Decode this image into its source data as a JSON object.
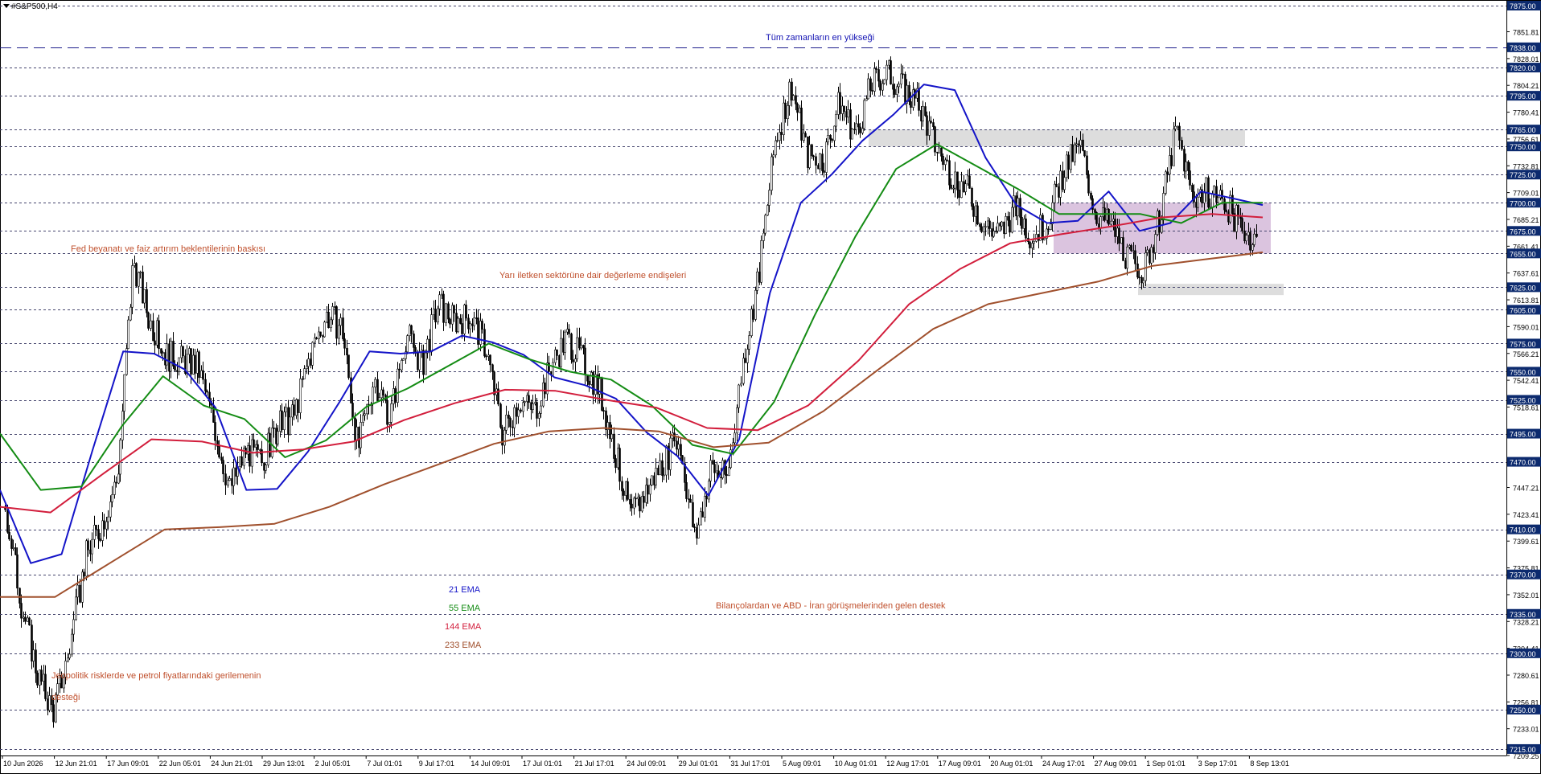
{
  "symbol": "#S&P500,H4",
  "chart_data": {
    "type": "candlestick",
    "title": "#S&P500,H4",
    "xlabel": "",
    "ylabel": "",
    "ylim": [
      7209.25,
      7880
    ],
    "grid": false,
    "price_ticks": [
      "7851.81",
      "7828.01",
      "7804.21",
      "7780.41",
      "7756.61",
      "7732.81",
      "7709.01",
      "7685.21",
      "7661.41",
      "7637.61",
      "7613.81",
      "7590.01",
      "7566.21",
      "7542.41",
      "7518.61",
      "7494.81",
      "7471.01",
      "7447.21",
      "7423.41",
      "7399.61",
      "7375.81",
      "7352.01",
      "7328.21",
      "7304.41",
      "7280.61",
      "7256.81",
      "7233.01",
      "7209.25"
    ],
    "level_labels": [
      "7875.00",
      "7838.00",
      "7820.00",
      "7795.00",
      "7765.00",
      "7750.00",
      "7725.00",
      "7700.00",
      "7675.00",
      "7655.00",
      "7625.00",
      "7605.00",
      "7575.00",
      "7550.00",
      "7525.00",
      "7495.00",
      "7470.00",
      "7410.00",
      "7370.00",
      "7335.00",
      "7300.00",
      "7250.00",
      "7215.00"
    ],
    "levels": [
      7875,
      7838,
      7820,
      7795,
      7765,
      7750,
      7725,
      7700,
      7675,
      7655,
      7625,
      7605,
      7575,
      7550,
      7525,
      7495,
      7470,
      7410,
      7370,
      7335,
      7300,
      7250,
      7215
    ],
    "ath_level": 7838,
    "x_labels": [
      "10 Jun 2026",
      "12 Jun 21:01",
      "17 Jun 09:01",
      "22 Jun 05:01",
      "24 Jun 21:01",
      "29 Jun 13:01",
      "2 Jul 05:01",
      "7 Jul 01:01",
      "9 Jul 17:01",
      "14 Jul 09:01",
      "17 Jul 01:01",
      "21 Jul 17:01",
      "24 Jul 09:01",
      "29 Jul 01:01",
      "31 Jul 17:01",
      "5 Aug 09:01",
      "10 Aug 01:01",
      "12 Aug 17:01",
      "17 Aug 09:01",
      "20 Aug 01:01",
      "24 Aug 17:01",
      "27 Aug 09:01",
      "1 Sep 01:01",
      "3 Sep 17:01",
      "8 Sep 13:01"
    ],
    "anchors": [
      7430,
      7345,
      7282,
      7248,
      7302,
      7385,
      7415,
      7455,
      7650,
      7595,
      7565,
      7560,
      7555,
      7505,
      7445,
      7480,
      7470,
      7500,
      7510,
      7565,
      7600,
      7590,
      7480,
      7545,
      7510,
      7585,
      7555,
      7610,
      7595,
      7600,
      7570,
      7495,
      7525,
      7515,
      7555,
      7580,
      7560,
      7535,
      7480,
      7420,
      7445,
      7470,
      7490,
      7400,
      7465,
      7455,
      7560,
      7640,
      7755,
      7805,
      7742,
      7738,
      7790,
      7760,
      7805,
      7815,
      7800,
      7785,
      7750,
      7725,
      7710,
      7680,
      7672,
      7695,
      7670,
      7685,
      7730,
      7750,
      7690,
      7678,
      7650,
      7640,
      7690,
      7765,
      7705,
      7710,
      7700,
      7680,
      7665
    ],
    "series": [
      {
        "name": "21 EMA",
        "color": "#1414c8",
        "values": [
          7445,
          7380,
          7388,
          7480,
          7568,
          7566,
          7552,
          7518,
          7445,
          7446,
          7479,
          7522,
          7568,
          7566,
          7568,
          7582,
          7576,
          7565,
          7545,
          7538,
          7526,
          7496,
          7475,
          7440,
          7490,
          7620,
          7700,
          7725,
          7755,
          7778,
          7805,
          7800,
          7740,
          7698,
          7682,
          7684,
          7710,
          7675,
          7682,
          7710,
          7704,
          7698
        ]
      },
      {
        "name": "55 EMA",
        "color": "#148c14",
        "values": [
          7495,
          7445,
          7448,
          7502,
          7546,
          7520,
          7508,
          7474,
          7489,
          7519,
          7535,
          7555,
          7575,
          7561,
          7550,
          7543,
          7520,
          7485,
          7477,
          7523,
          7600,
          7670,
          7730,
          7752,
          7732,
          7712,
          7690,
          7690,
          7690,
          7682,
          7700,
          7700
        ]
      },
      {
        "name": "144 EMA",
        "color": "#d21e3c",
        "values": [
          7430,
          7425,
          7458,
          7490,
          7488,
          7478,
          7481,
          7488,
          7507,
          7522,
          7534,
          7533,
          7525,
          7518,
          7500,
          7498,
          7520,
          7560,
          7610,
          7641,
          7664,
          7672,
          7679,
          7687,
          7690,
          7687
        ]
      },
      {
        "name": "233 EMA",
        "color": "#a0502d",
        "values": [
          7350,
          7350,
          7380,
          7410,
          7412,
          7415,
          7430,
          7450,
          7468,
          7486,
          7497,
          7500,
          7497,
          7483,
          7487,
          7515,
          7552,
          7588,
          7610,
          7620,
          7630,
          7644,
          7650,
          7656
        ]
      }
    ],
    "ema_legend": [
      "21 EMA",
      "55 EMA",
      "144 EMA",
      "233 EMA"
    ],
    "zones": [
      {
        "label": "",
        "from": 7750,
        "to": 7765,
        "color": "#d9d9d9"
      },
      {
        "label": "",
        "from": 7655,
        "to": 7700,
        "color": "#d7bedc"
      },
      {
        "label": "",
        "from": 7618,
        "to": 7628,
        "color": "#d9d9d9"
      }
    ],
    "annotations": [
      {
        "text": "Tüm zamanların en yükseği",
        "color": "#1414b4"
      },
      {
        "text": "Fed beyanatı ve faiz artırım beklentilerinin baskısı",
        "color": "#c0502d"
      },
      {
        "text": "Yarı iletken sektörüne dair değerleme endişeleri",
        "color": "#c0502d"
      },
      {
        "text": "Bilançolardan ve ABD - İran görüşmelerinden gelen destek",
        "color": "#c0502d"
      },
      {
        "text": "Jeopolitik risklerde ve petrol fiyatlarındaki gerilemenin",
        "color": "#c0502d"
      },
      {
        "text": "desteği",
        "color": "#c0502d"
      }
    ]
  }
}
